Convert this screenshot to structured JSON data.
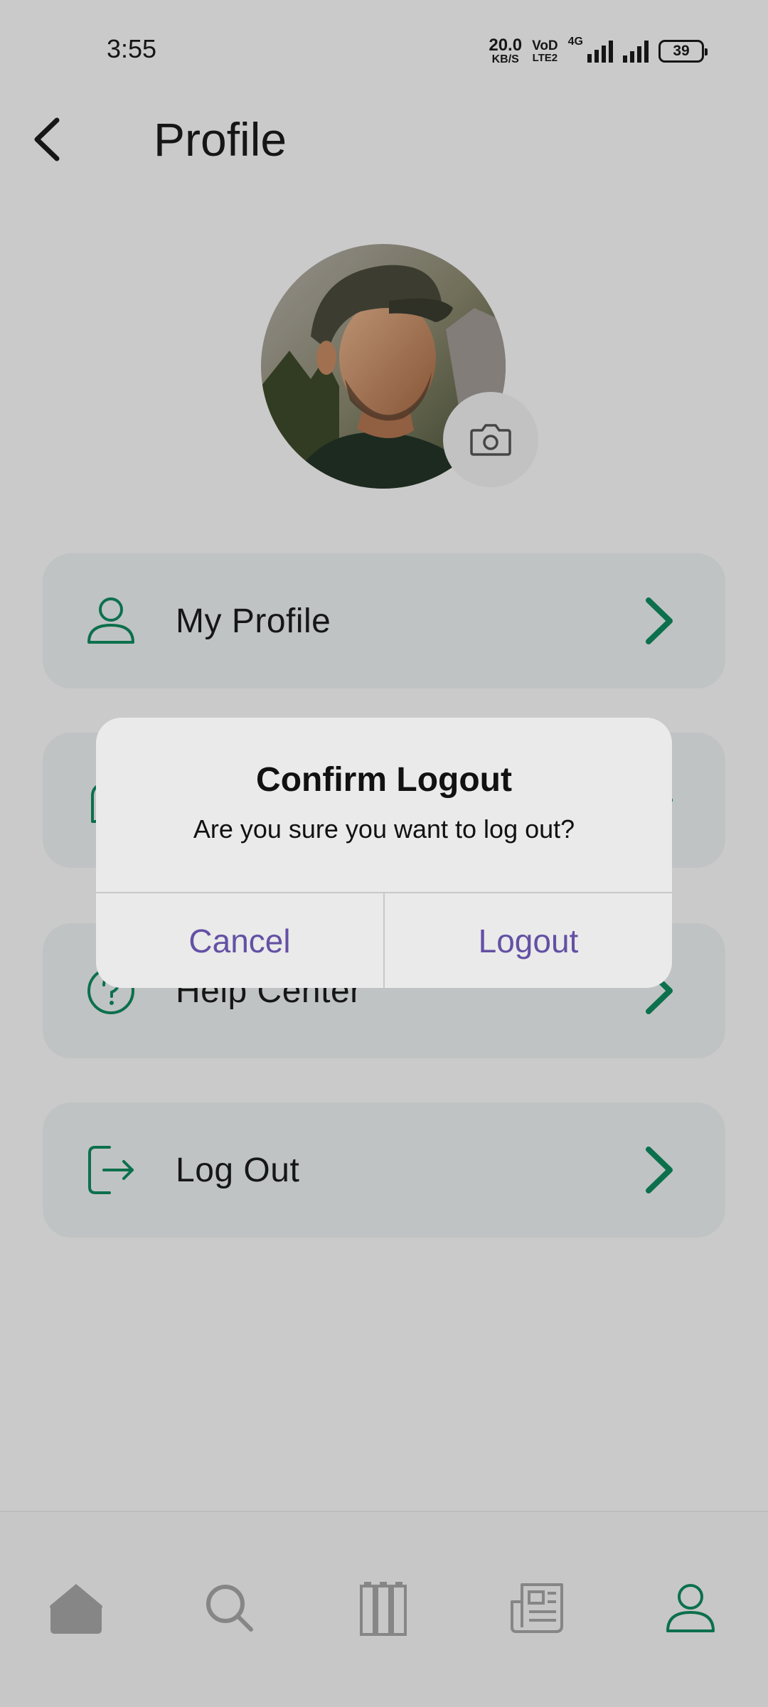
{
  "status_bar": {
    "time": "3:55",
    "net_speed_value": "20.0",
    "net_speed_unit": "KB/S",
    "volte_top": "VoD",
    "volte_bottom": "LTE2",
    "network_type": "4G",
    "battery": "39"
  },
  "header": {
    "title": "Profile",
    "back_icon": "chevron-left-icon"
  },
  "avatar": {
    "camera_icon": "camera-icon"
  },
  "menu": {
    "items": [
      {
        "label": "My Profile",
        "icon": "user-icon"
      },
      {
        "label": "",
        "icon": "lock-icon"
      },
      {
        "label": "Help Center",
        "icon": "help-icon"
      },
      {
        "label": "Log Out",
        "icon": "logout-icon"
      }
    ]
  },
  "bottom_nav": {
    "items": [
      "home-icon",
      "search-icon",
      "library-icon",
      "news-icon",
      "profile-icon"
    ],
    "active": "profile-icon"
  },
  "dialog": {
    "title": "Confirm Logout",
    "message": "Are you sure you want to log out?",
    "cancel_label": "Cancel",
    "confirm_label": "Logout"
  },
  "colors": {
    "accent_green": "#0f8a5f",
    "dialog_button": "#6450a4",
    "nav_inactive": "#a6a6a6"
  }
}
